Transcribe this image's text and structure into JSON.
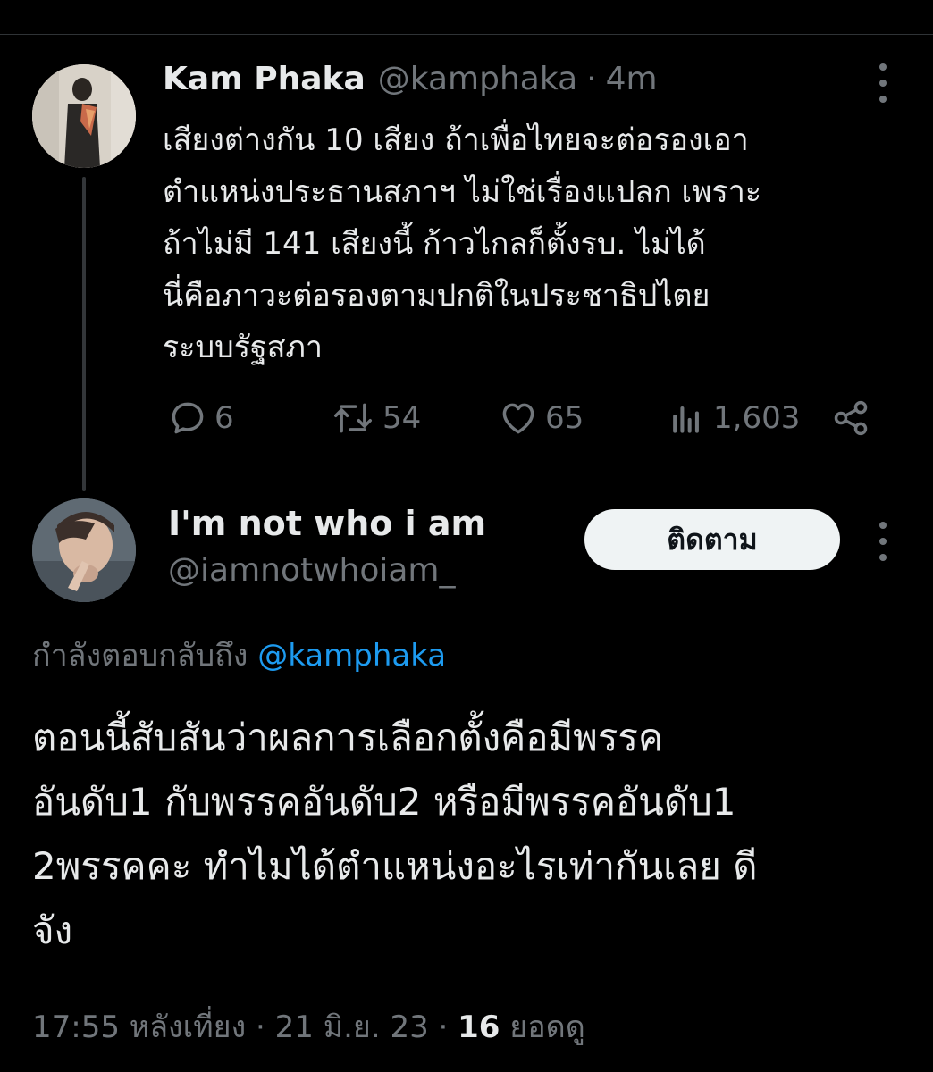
{
  "parent_tweet": {
    "author_name": "Kam Phaka",
    "author_handle": "@kamphaka",
    "separator": "·",
    "time_ago": "4m",
    "text_lines": [
      "เสียงต่างกัน 10 เสียง ถ้าเพื่อไทยจะต่อรองเอา",
      "ตำแหน่งประธานสภาฯ ไม่ใช่เรื่องแปลก เพราะ",
      "ถ้าไม่มี 141 เสียงนี้ ก้าวไกลก็ตั้งรบ. ไม่ได้",
      "นี่คือภาวะต่อรองตามปกติในประชาธิปไตย",
      "ระบบรัฐสภา"
    ],
    "actions": {
      "reply_count": "6",
      "retweet_count": "54",
      "like_count": "65",
      "view_count": "1,603"
    },
    "icons": [
      "reply-icon",
      "retweet-icon",
      "like-icon",
      "views-icon",
      "share-icon",
      "more-icon"
    ]
  },
  "reply_tweet": {
    "author_name": "I'm not who i am",
    "author_handle": "@iamnotwhoiam_",
    "follow_label": "ติดตาม",
    "replying_to_prefix": "กำลังตอบกลับถึง",
    "replying_to_handle": "@kamphaka",
    "text_lines": [
      "ตอนนี้สับสันว่าผลการเลือกตั้งคือมีพรรค",
      "อันดับ1 กับพรรคอันดับ2 หรือมีพรรคอันดับ1",
      "2พรรคคะ ทำไมได้ตำแหน่งอะไรเท่ากันเลย ดี",
      "จัง"
    ],
    "timestamp": "17:55 หลังเที่ยง · 21 มิ.ย. 23 ·",
    "views_count": "16",
    "views_label": "ยอดดู"
  },
  "colors": {
    "background": "#000000",
    "text": "#e7e9ea",
    "muted": "#71767b",
    "link": "#1d9bf0",
    "button_bg": "#eff3f4"
  }
}
